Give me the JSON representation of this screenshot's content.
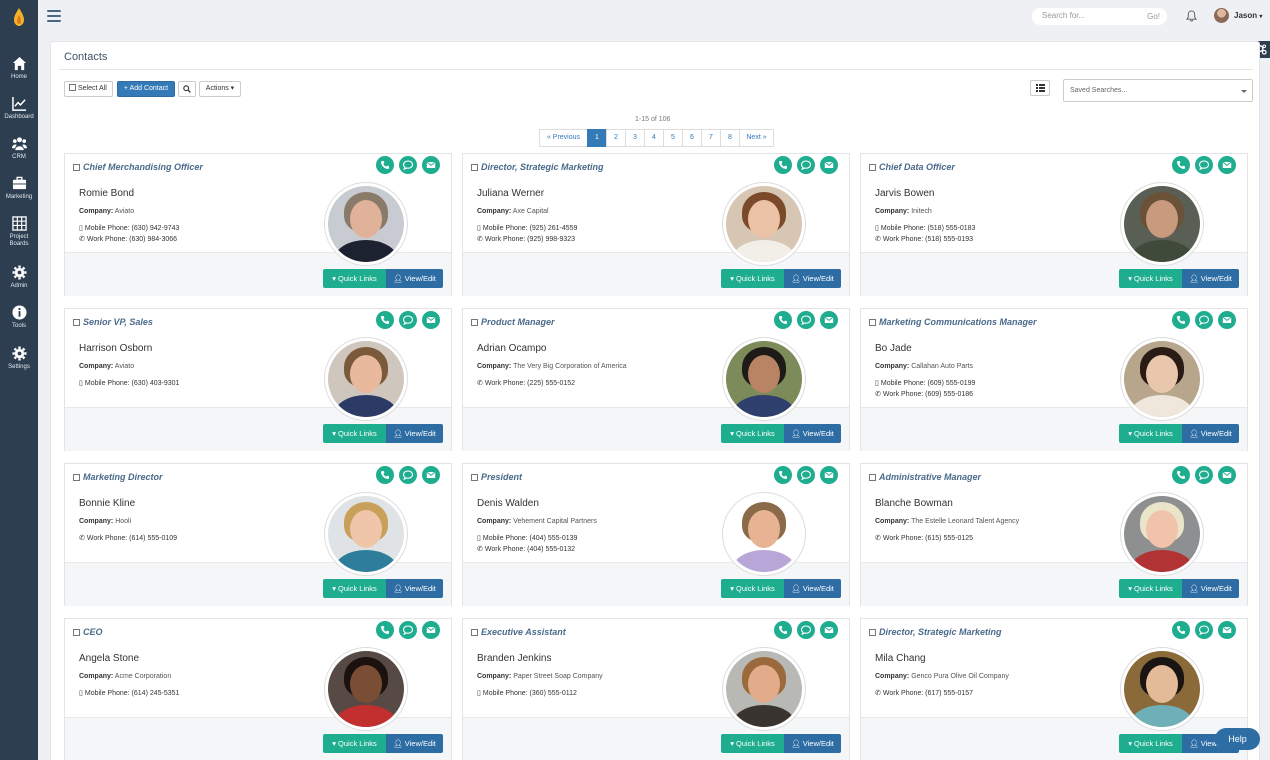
{
  "sidebar": {
    "items": [
      {
        "label": "Home",
        "icon": "home-icon"
      },
      {
        "label": "Dashboard",
        "icon": "chart-icon"
      },
      {
        "label": "CRM",
        "icon": "users-icon"
      },
      {
        "label": "Marketing",
        "icon": "briefcase-icon"
      },
      {
        "label": "Project Boards",
        "icon": "table-icon"
      },
      {
        "label": "Admin",
        "icon": "gear-icon"
      },
      {
        "label": "Tools",
        "icon": "info-icon"
      },
      {
        "label": "Settings",
        "icon": "gear-icon"
      }
    ]
  },
  "topbar": {
    "search_placeholder": "Search for...",
    "search_go": "Go!",
    "user_name": "Jason"
  },
  "page": {
    "title": "Contacts",
    "select_all": "Select All",
    "add_contact": "+ Add Contact",
    "actions": "Actions ▾",
    "saved_searches": "Saved Searches...",
    "range": "1-15 of 106"
  },
  "pagination": [
    "« Previous",
    "1",
    "2",
    "3",
    "4",
    "5",
    "6",
    "7",
    "8",
    "Next »"
  ],
  "card_buttons": {
    "quick_links": "▾ Quick Links",
    "view_edit": "View/Edit"
  },
  "help": "Help",
  "contacts": [
    {
      "title": "Chief Merchandising Officer",
      "name": "Romie Bond",
      "company": "Aviato",
      "phones": [
        {
          "type": "mobile",
          "text": "Mobile Phone: (630) 942-9743"
        },
        {
          "type": "work",
          "text": "Work Phone: (630) 984-3066"
        }
      ]
    },
    {
      "title": "Director, Strategic Marketing",
      "name": "Juliana Werner",
      "company": "Axe Capital",
      "phones": [
        {
          "type": "mobile",
          "text": "Mobile Phone: (925) 261-4559"
        },
        {
          "type": "work",
          "text": "Work Phone: (925) 998-9323"
        }
      ]
    },
    {
      "title": "Chief Data Officer",
      "name": "Jarvis Bowen",
      "company": "Initech",
      "phones": [
        {
          "type": "mobile",
          "text": "Mobile Phone: (518) 555-0183"
        },
        {
          "type": "work",
          "text": "Work Phone: (518) 555-0193"
        }
      ]
    },
    {
      "title": "Senior VP, Sales",
      "name": "Harrison Osborn",
      "company": "Aviato",
      "phones": [
        {
          "type": "mobile",
          "text": "Mobile Phone: (630) 403-9301"
        }
      ]
    },
    {
      "title": "Product Manager",
      "name": "Adrian Ocampo",
      "company": "The Very Big Corporation of America",
      "phones": [
        {
          "type": "work",
          "text": "Work Phone: (225) 555-0152"
        }
      ]
    },
    {
      "title": "Marketing Communications Manager",
      "name": "Bo Jade",
      "company": "Callahan Auto Parts",
      "phones": [
        {
          "type": "mobile",
          "text": "Mobile Phone: (609) 555-0199"
        },
        {
          "type": "work",
          "text": "Work Phone: (609) 555-0186"
        }
      ]
    },
    {
      "title": "Marketing Director",
      "name": "Bonnie Kline",
      "company": "Hooli",
      "phones": [
        {
          "type": "work",
          "text": "Work Phone: (614) 555-0109"
        }
      ]
    },
    {
      "title": "President",
      "name": "Denis Walden",
      "company": "Vehement Capital Partners",
      "phones": [
        {
          "type": "mobile",
          "text": "Mobile Phone: (404) 555-0139"
        },
        {
          "type": "work",
          "text": "Work Phone: (404) 555-0132"
        }
      ]
    },
    {
      "title": "Administrative Manager",
      "name": "Blanche Bowman",
      "company": "The Estelle Leonard Talent Agency",
      "phones": [
        {
          "type": "work",
          "text": "Work Phone: (615) 555-0125"
        }
      ]
    },
    {
      "title": "CEO",
      "name": "Angela Stone",
      "company": "Acme Corporation",
      "phones": [
        {
          "type": "mobile",
          "text": "Mobile Phone: (614) 245-5351"
        }
      ]
    },
    {
      "title": "Executive Assistant",
      "name": "Branden Jenkins",
      "company": "Paper Street Soap Company",
      "phones": [
        {
          "type": "mobile",
          "text": "Mobile Phone: (360) 555-0112"
        }
      ]
    },
    {
      "title": "Director, Strategic Marketing",
      "name": "Mila Chang",
      "company": "Genco Pura Olive Oil Company",
      "phones": [
        {
          "type": "work",
          "text": "Work Phone: (617) 555-0157"
        }
      ]
    }
  ],
  "colors": {
    "sidebar": "#2d3e50",
    "accent_green": "#1fad8f",
    "primary_blue": "#337ab7",
    "title_blue": "#4a6a8a"
  }
}
